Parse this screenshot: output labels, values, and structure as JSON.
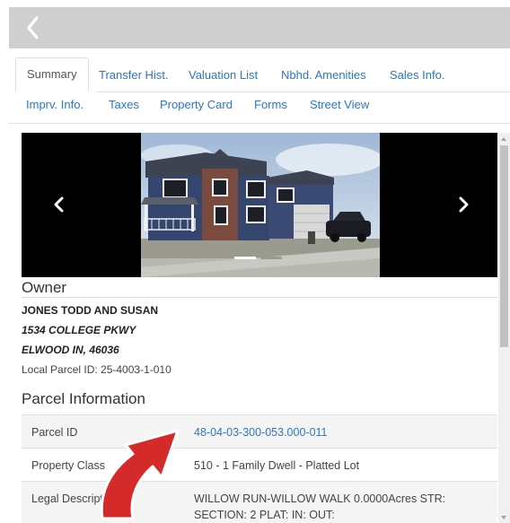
{
  "header": {
    "back_icon": "chevron-left-icon",
    "background": "#cfcfcf"
  },
  "tabs": [
    {
      "label": "Summary",
      "active": true
    },
    {
      "label": "Transfer Hist."
    },
    {
      "label": "Valuation List"
    },
    {
      "label": "Nbhd. Amenities"
    },
    {
      "label": "Sales Info."
    },
    {
      "label": "Imprv. Info."
    },
    {
      "label": "Taxes"
    },
    {
      "label": "Property Card"
    },
    {
      "label": "Forms"
    },
    {
      "label": "Street View"
    }
  ],
  "carousel": {
    "prev_icon": "chevron-left-icon",
    "next_icon": "chevron-right-icon",
    "slide_count": 2,
    "active_slide": 1
  },
  "owner": {
    "heading": "Owner",
    "name": "JONES TODD AND SUSAN",
    "address_line1": "1534 COLLEGE PKWY",
    "address_line2": "ELWOOD IN, 46036",
    "local_parcel": "Local Parcel ID: 25-4003-1-010"
  },
  "parcel": {
    "heading": "Parcel Information",
    "rows": [
      {
        "label": "Parcel ID",
        "value": "48-04-03-300-053.000-011",
        "link": true
      },
      {
        "label": "Property Class",
        "value": "510 - 1 Family Dwell - Platted Lot"
      },
      {
        "label": "Legal Description",
        "value": "WILLOW RUN-WILLOW WALK 0.0000Acres STR: SECTION: 2 PLAT: IN: OUT:"
      }
    ]
  },
  "colors": {
    "link": "#2a77c9",
    "annotation_arrow": "#d42a2a"
  }
}
